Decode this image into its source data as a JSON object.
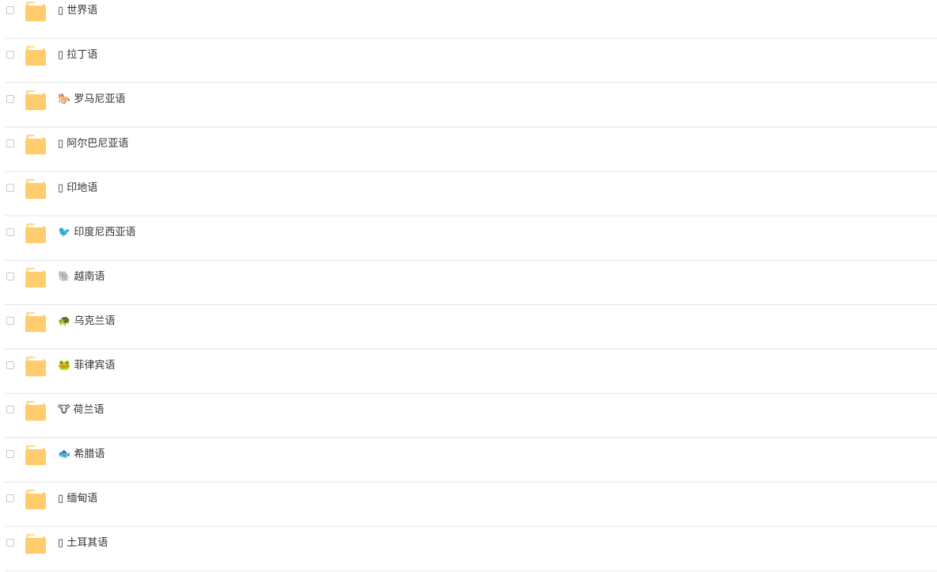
{
  "colors": {
    "folder_body": "#FFCD6E",
    "folder_tab": "#FFD88A",
    "folder_paper": "#FFFFFF",
    "divider": "#E6E6E6",
    "text": "#333333"
  },
  "files": [
    {
      "icon": "missing-glyph",
      "emoji": "▯",
      "name": "世界语"
    },
    {
      "icon": "missing-glyph",
      "emoji": "▯",
      "name": "拉丁语"
    },
    {
      "icon": "horse-icon",
      "emoji": "🐎",
      "name": "罗马尼亚语"
    },
    {
      "icon": "missing-glyph",
      "emoji": "▯",
      "name": "阿尔巴尼亚语"
    },
    {
      "icon": "missing-glyph",
      "emoji": "▯",
      "name": "印地语"
    },
    {
      "icon": "bird-icon",
      "emoji": "🐦",
      "name": "印度尼西亚语"
    },
    {
      "icon": "elephant-icon",
      "emoji": "🐘",
      "name": "越南语"
    },
    {
      "icon": "turtle-icon",
      "emoji": "🐢",
      "name": "乌克兰语"
    },
    {
      "icon": "frog-icon",
      "emoji": "🐸",
      "name": "菲律宾语"
    },
    {
      "icon": "cow-icon",
      "emoji": "🐮",
      "name": "荷兰语"
    },
    {
      "icon": "fish-icon",
      "emoji": "🐟",
      "name": "希腊语"
    },
    {
      "icon": "missing-glyph",
      "emoji": "▯",
      "name": "缅甸语"
    },
    {
      "icon": "missing-glyph",
      "emoji": "▯",
      "name": "土耳其语"
    }
  ]
}
